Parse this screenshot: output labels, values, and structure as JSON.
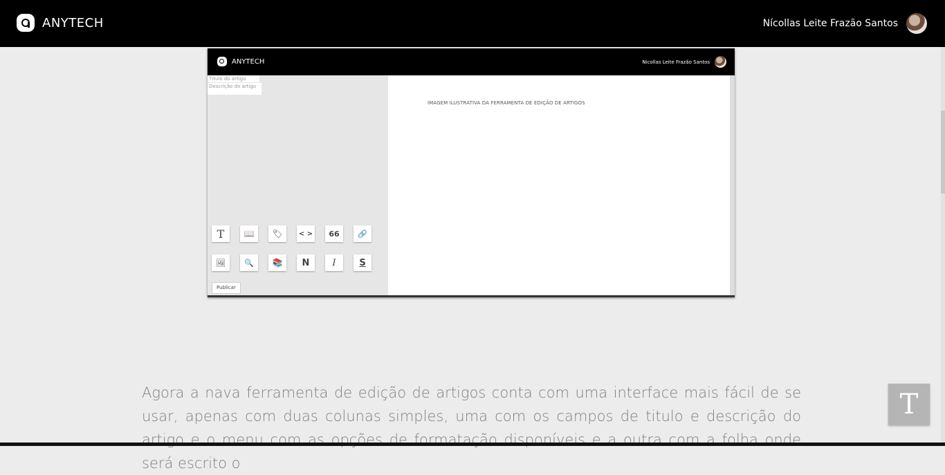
{
  "header": {
    "brand": "ANYTECH",
    "user_name": "Nícollas Leite Frazão Santos"
  },
  "preview": {
    "brand": "ANYTECH",
    "user_name": "Nicollas Leite Frazão Santos",
    "title_placeholder": "Título do artigo",
    "description_placeholder": "Descrição do artigo",
    "caption": "IMAGEM ILUSTRATIVA DA FERRAMENTA DE EDIÇÃO DE ARTIGOS",
    "publish_label": "Publicar",
    "tools_row1": [
      {
        "icon": "text-icon",
        "glyph": "T"
      },
      {
        "icon": "book-icon",
        "glyph": "📖"
      },
      {
        "icon": "tag-icon",
        "glyph": "🏷"
      },
      {
        "icon": "code-icon",
        "glyph": "< >"
      },
      {
        "icon": "quote-icon",
        "glyph": "66"
      },
      {
        "icon": "link-icon",
        "glyph": "🔗"
      }
    ],
    "tools_row2": [
      {
        "icon": "image-icon",
        "glyph": "🖼"
      },
      {
        "icon": "search-document-icon",
        "glyph": "🔍"
      },
      {
        "icon": "library-icon",
        "glyph": "📚"
      },
      {
        "icon": "bold-icon",
        "glyph": "N"
      },
      {
        "icon": "italic-icon",
        "glyph": "I"
      },
      {
        "icon": "strikethrough-icon",
        "glyph": "S"
      }
    ]
  },
  "article": {
    "paragraph": "Agora a nava ferramenta de edição de artigos conta com uma interface mais fácil de se usar, apenas com duas colunas simples, uma com os campos de titulo e descrição do artigo e o menu com as opções de formatação disponíveis e a outra com a folha onde será escrito o"
  },
  "fab": {
    "label": "T"
  }
}
